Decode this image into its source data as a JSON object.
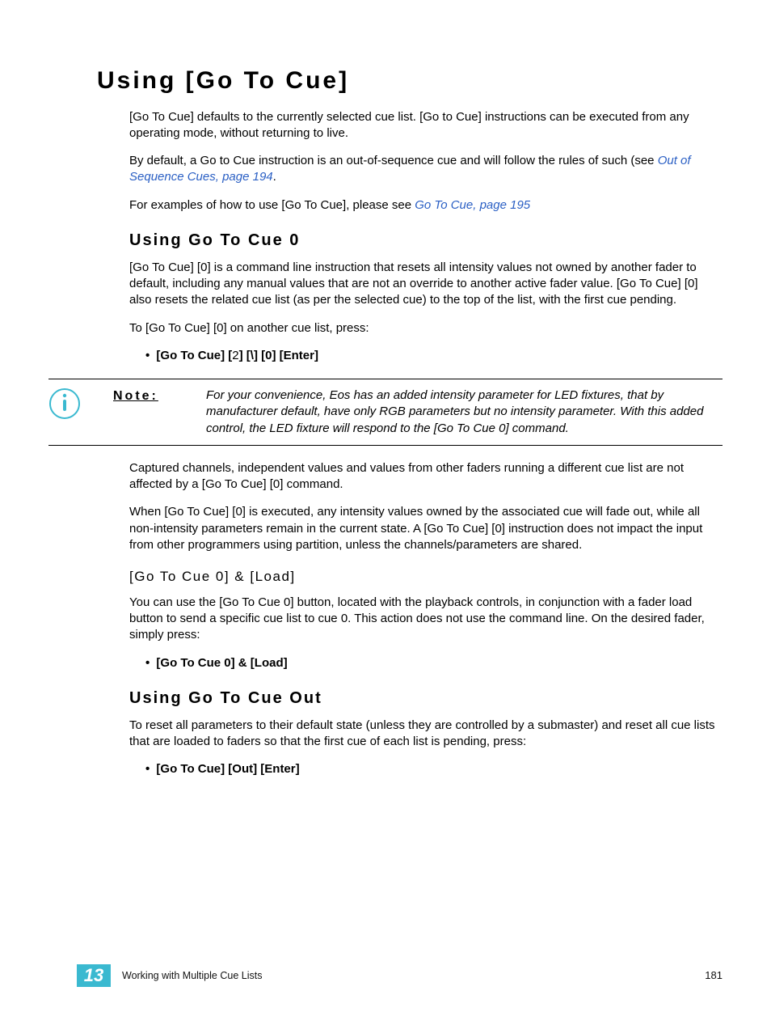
{
  "h1": "Using [Go To Cue]",
  "intro1": "[Go To Cue] defaults to the currently selected cue list. [Go to Cue] instructions can be executed from any operating mode, without returning to live.",
  "intro2_pre": "By default, a Go to Cue instruction is an out-of-sequence cue and will follow the rules of such (see ",
  "intro2_link": "Out of Sequence Cues, page 194",
  "intro2_post": ".",
  "intro3_pre": "For examples of how to use [Go To Cue], please see ",
  "intro3_link": "Go To Cue, page 195",
  "sec1_h2": "Using Go To Cue 0",
  "sec1_p1": "[Go To Cue] [0] is a command line instruction that resets all intensity values not owned by another fader to default, including any manual values that are not an override to another active fader value. [Go To Cue] [0] also resets the related cue list (as per the selected cue) to the top of the list, with the first cue pending.",
  "sec1_p2": "To [Go To Cue] [0] on another cue list, press:",
  "sec1_cmd_a": "[Go To Cue] [",
  "sec1_cmd_mid": "2",
  "sec1_cmd_b": "] [\\] [0] [Enter]",
  "note_label": "Note:",
  "note_text": "For your convenience, Eos has an added intensity parameter for LED fixtures, that by manufacturer default, have only RGB parameters but no intensity parameter. With this added control, the LED fixture will respond to the [Go To Cue 0] command.",
  "after_note_p1": "Captured channels, independent values and values from other faders running a different cue list are not affected by a [Go To Cue] [0] command.",
  "after_note_p2": "When [Go To Cue] [0] is executed, any intensity values owned by the associated cue will fade out, while all non-intensity parameters remain in the current state. A [Go To Cue] [0] instruction does not impact the input from other programmers using partition, unless the channels/parameters are shared.",
  "sec1_h3": "[Go To Cue 0] & [Load]",
  "sec1_h3_p1": "You can use the [Go To Cue 0] button, located with the playback controls, in conjunction with a fader load button to send a specific cue list to cue 0. This action does not use the command line. On the desired fader, simply press:",
  "sec1_h3_cmd": "[Go To Cue 0] & [Load]",
  "sec2_h2": "Using Go To Cue Out",
  "sec2_p1": "To reset all parameters to their default state (unless they are controlled by a submaster) and reset all cue lists that are loaded to faders so that the first cue of each list is pending, press:",
  "sec2_cmd": "[Go To Cue] [Out] [Enter]",
  "footer_chapter": "13",
  "footer_title": "Working with Multiple Cue Lists",
  "footer_page": "181"
}
